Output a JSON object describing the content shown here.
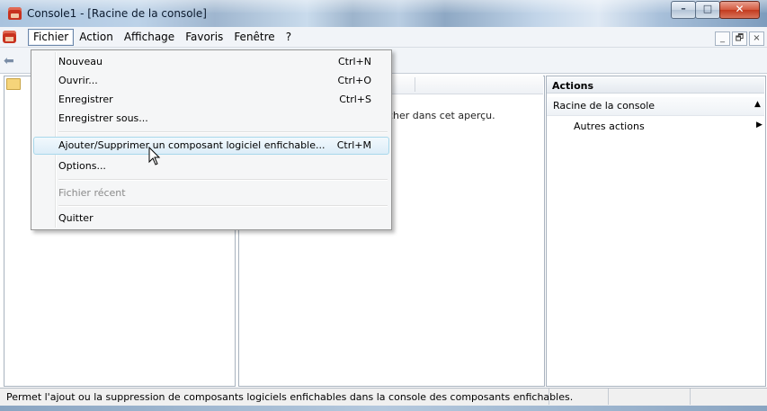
{
  "window": {
    "title": "Console1 - [Racine de la console]",
    "controls": {
      "minimize": "–",
      "maximize": "□",
      "close": "✕"
    }
  },
  "menubar": {
    "items": [
      "Fichier",
      "Action",
      "Affichage",
      "Favoris",
      "Fenêtre",
      "?"
    ],
    "active": "Fichier",
    "mdi_controls": [
      "_",
      "🗗",
      "×"
    ]
  },
  "toolbar": {
    "back_glyph": "⬅"
  },
  "file_menu": {
    "items": [
      {
        "label": "Nouveau",
        "shortcut": "Ctrl+N"
      },
      {
        "label": "Ouvrir...",
        "shortcut": "Ctrl+O"
      },
      {
        "label": "Enregistrer",
        "shortcut": "Ctrl+S"
      },
      {
        "label": "Enregistrer sous...",
        "shortcut": ""
      },
      {
        "label": "Ajouter/Supprimer un composant logiciel enfichable...",
        "shortcut": "Ctrl+M",
        "highlighted": true
      },
      {
        "label": "Options...",
        "shortcut": ""
      },
      {
        "label": "Fichier récent",
        "shortcut": "",
        "disabled": true
      },
      {
        "label": "Quitter",
        "shortcut": ""
      }
    ]
  },
  "center_pane": {
    "visible_text": "cher dans cet aperçu."
  },
  "actions_pane": {
    "title": "Actions",
    "section": "Racine de la console",
    "section_caret": "▲",
    "more_actions": "Autres actions",
    "more_caret": "▶"
  },
  "statusbar": {
    "text": "Permet l'ajout ou la suppression de composants logiciels enfichables dans la console des composants enfichables."
  }
}
